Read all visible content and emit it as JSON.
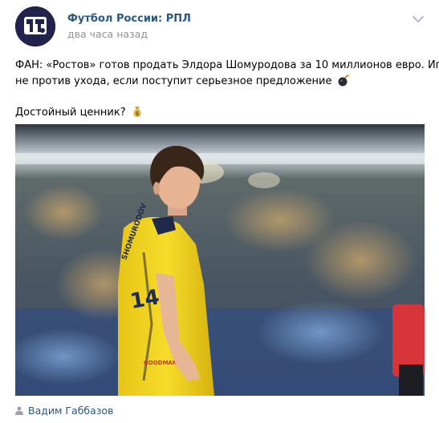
{
  "post": {
    "author": "Футбол России: РПЛ",
    "time": "два часа назад",
    "text_line1": "ФАН: «Ростов» готов продать Элдора Шомуродова за 10 миллионов евро. Игрок",
    "text_line2": "не против ухода, если поступит серьезное предложение",
    "text_line3": "Достойный ценник?",
    "signer": "Вадим Габбазов"
  },
  "photo": {
    "jersey_number": "14",
    "jersey_name": "SHOMURODOV",
    "sponsor": "GOODMAN"
  },
  "icons": {
    "avatar": "fr-logo",
    "menu": "chevron-down-icon",
    "emoji1": "bomb-icon",
    "emoji2": "money-bag-icon",
    "signer": "person-icon"
  },
  "colors": {
    "link": "#2a5885",
    "muted": "#939393",
    "jersey": "#f2d21c"
  }
}
